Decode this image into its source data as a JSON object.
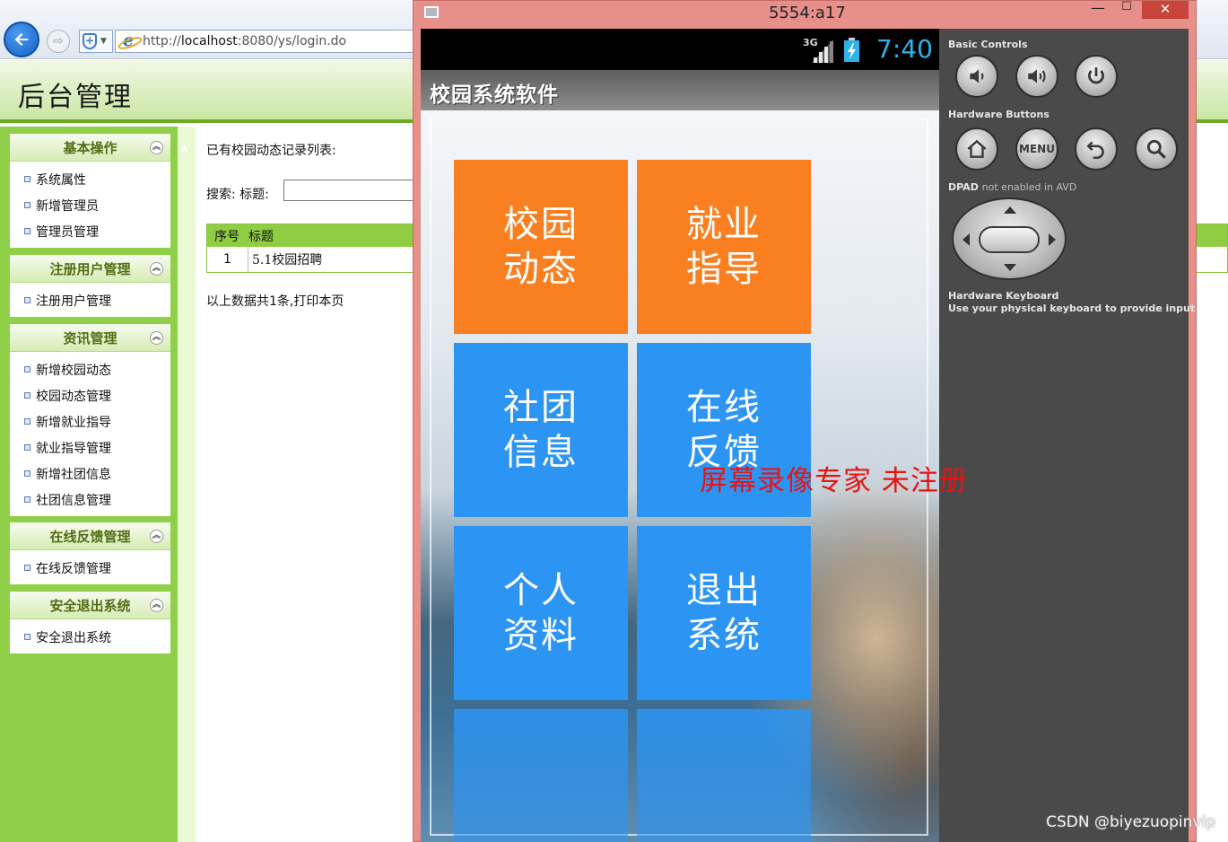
{
  "browser": {
    "url_prefix": "http://",
    "url_host": "localhost",
    "url_rest": ":8080/ys/login.do"
  },
  "admin": {
    "title": "后台管理",
    "groups": [
      {
        "title": "基本操作",
        "items": [
          "系统属性",
          "新增管理员",
          "管理员管理"
        ]
      },
      {
        "title": "注册用户管理",
        "items": [
          "注册用户管理"
        ]
      },
      {
        "title": "资讯管理",
        "items": [
          "新增校园动态",
          "校园动态管理",
          "新增就业指导",
          "就业指导管理",
          "新增社团信息",
          "社团信息管理"
        ]
      },
      {
        "title": "在线反馈管理",
        "items": [
          "在线反馈管理"
        ]
      },
      {
        "title": "安全退出系统",
        "items": [
          "安全退出系统"
        ]
      }
    ],
    "content": {
      "list_title": "已有校园动态记录列表:",
      "search_label": "搜索:  标题:",
      "table_headers": [
        "序号",
        "标题"
      ],
      "rows": [
        {
          "no": "1",
          "title": "5.1校园招聘"
        }
      ],
      "footer": "以上数据共1条,打印本页"
    }
  },
  "emulator": {
    "window_title": "5554:a17",
    "status": {
      "network": "3G",
      "time": "7:40",
      "time_color": "#2fb2ea"
    },
    "app_title": "校园系统软件",
    "tiles": [
      {
        "line1": "校园",
        "line2": "动态",
        "color": "#fa7f21"
      },
      {
        "line1": "就业",
        "line2": "指导",
        "color": "#fa7f21"
      },
      {
        "line1": "社团",
        "line2": "信息",
        "color": "#2c95f4"
      },
      {
        "line1": "在线",
        "line2": "反馈",
        "color": "#2c95f4"
      },
      {
        "line1": "个人",
        "line2": "资料",
        "color": "#2c95f4"
      },
      {
        "line1": "退出",
        "line2": "系统",
        "color": "#2c95f4"
      }
    ],
    "controls": {
      "basic_controls_label": "Basic Controls",
      "hardware_buttons_label": "Hardware Buttons",
      "menu_label": "MENU",
      "dpad_label": "DPAD",
      "dpad_note": "not enabled in AVD",
      "keyboard_label": "Hardware Keyboard",
      "keyboard_note": "Use your physical keyboard to provide input"
    }
  },
  "overlays": {
    "recorder_watermark": "屏幕录像专家  未注册",
    "csdn_watermark": "CSDN @biyezuopinvip"
  }
}
